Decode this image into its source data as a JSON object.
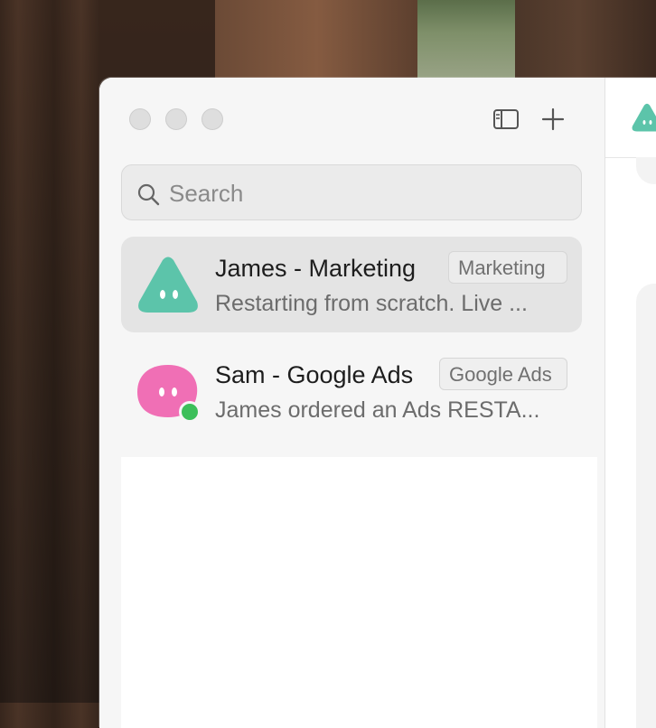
{
  "window": {
    "controls": [
      "close",
      "minimize",
      "zoom"
    ]
  },
  "toolbar": {
    "sidebar_toggle_icon": "sidebar-icon",
    "new_chat_icon": "plus-icon"
  },
  "search": {
    "placeholder": "Search",
    "value": ""
  },
  "chats": [
    {
      "name": "James - Marketing",
      "tag": "Marketing",
      "preview": "Restarting from scratch. Live ...",
      "avatar_color": "#5cc4aa",
      "avatar_shape": "triangle",
      "selected": true,
      "online": false
    },
    {
      "name": "Sam - Google Ads",
      "tag": "Google Ads",
      "preview": "James ordered an Ads RESTA...",
      "avatar_color": "#f06fb5",
      "avatar_shape": "blob",
      "selected": false,
      "online": true
    }
  ],
  "colors": {
    "accent_teal": "#5cc4aa",
    "accent_pink": "#f06fb5",
    "online_green": "#3cbf5a",
    "selected_bg": "#e4e4e4"
  }
}
